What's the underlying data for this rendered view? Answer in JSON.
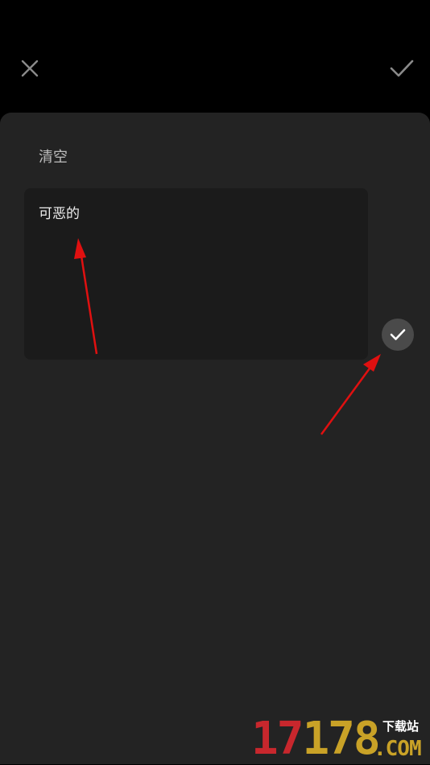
{
  "toolbar": {
    "close_icon": "close-icon",
    "confirm_icon": "check-icon"
  },
  "editor": {
    "clear_label": "清空",
    "text_value": "可恶的",
    "apply_icon": "check-circle-icon"
  },
  "annotations": {
    "arrow_color": "#e01010"
  },
  "watermark": {
    "digits": [
      "1",
      "7",
      "1",
      "7",
      "8"
    ],
    "cn": "下载站",
    "com": ".COM"
  },
  "colors": {
    "top_bg": "#000000",
    "sheet_bg": "#232323",
    "input_bg": "#1b1b1b",
    "apply_btn_bg": "#4a4a4a"
  }
}
